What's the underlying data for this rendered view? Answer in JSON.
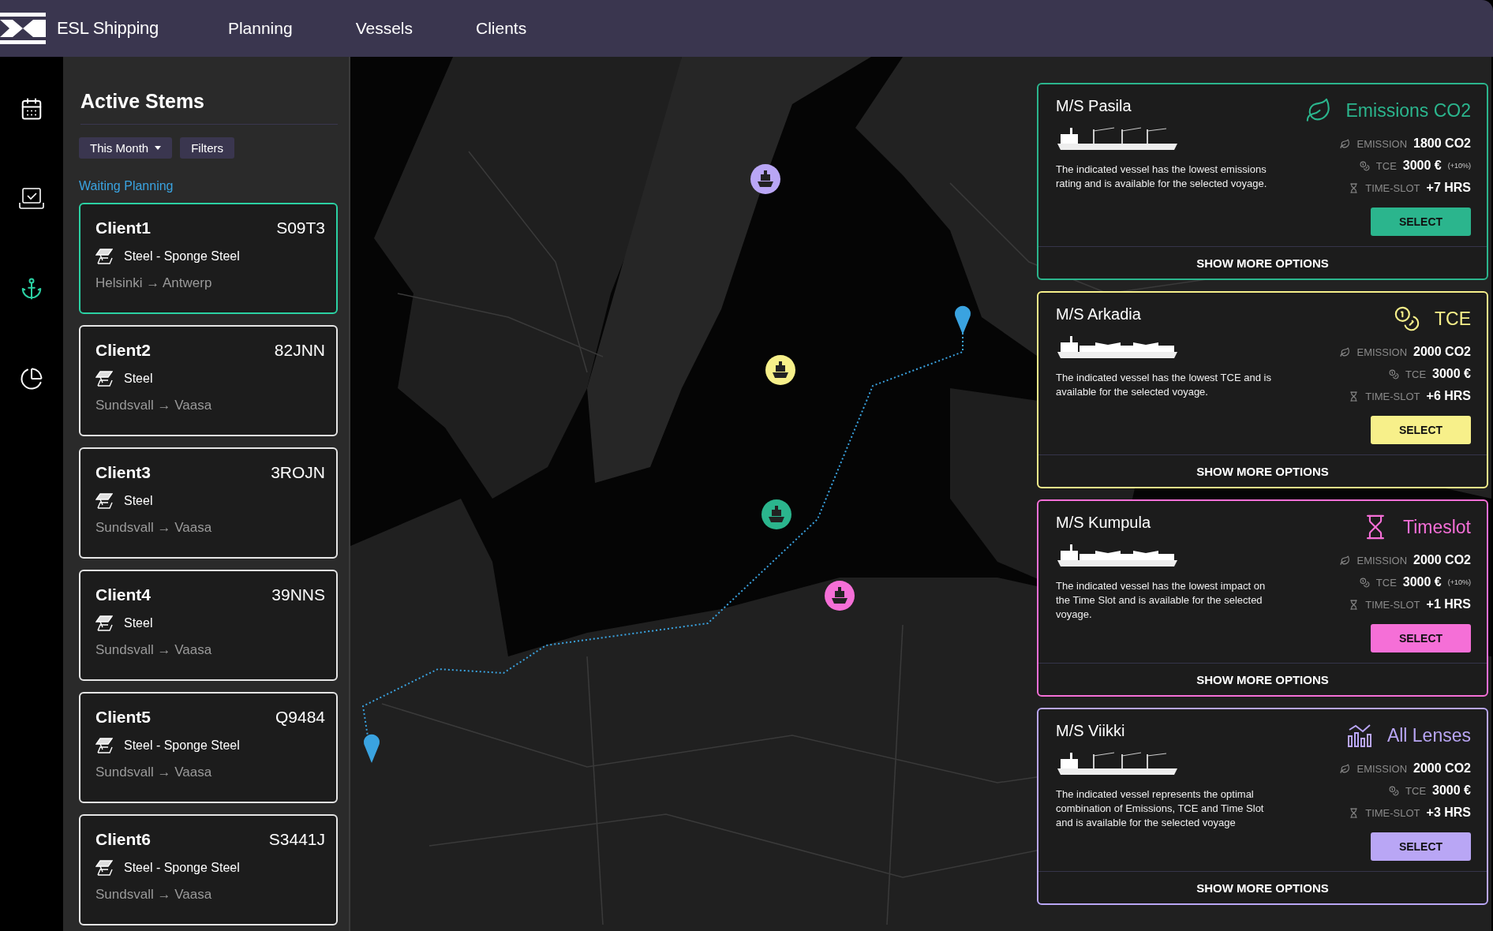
{
  "brand": {
    "name": "ESL Shipping"
  },
  "nav": [
    "Planning",
    "Vessels",
    "Clients"
  ],
  "sidebar": {
    "items": [
      {
        "kind": "calendar",
        "selected": false
      },
      {
        "kind": "laptop",
        "selected": false
      },
      {
        "kind": "anchor",
        "selected": true
      },
      {
        "kind": "pie",
        "selected": false
      }
    ]
  },
  "stems": {
    "title": "Active Stems",
    "filters": [
      {
        "label": "This Month",
        "kind": "dropdown"
      },
      {
        "label": "Filters",
        "kind": "plain"
      }
    ],
    "section": "Waiting Planning",
    "clients": [
      {
        "name": "Client1",
        "code": "S09T3",
        "cargo": "Steel - Sponge Steel",
        "route": "Helsinki → Antwerp",
        "selected": true
      },
      {
        "name": "Client2",
        "code": "82JNN",
        "cargo": "Steel",
        "route": "Sundsvall → Vaasa",
        "selected": false
      },
      {
        "name": "Client3",
        "code": "3ROJN",
        "cargo": "Steel",
        "route": "Sundsvall → Vaasa",
        "selected": false
      },
      {
        "name": "Client4",
        "code": "39NNS",
        "cargo": "Steel",
        "route": "Sundsvall → Vaasa",
        "selected": false
      },
      {
        "name": "Client5",
        "code": "Q9484",
        "cargo": "Steel - Sponge Steel",
        "route": "Sundsvall → Vaasa",
        "selected": false
      },
      {
        "name": "Client6",
        "code": "S3441J",
        "cargo": "Steel - Sponge Steel",
        "route": "Sundsvall → Vaasa",
        "selected": false
      }
    ]
  },
  "map": {
    "markers": [
      {
        "color": "#b9a6f5"
      },
      {
        "color": "#f7f08a"
      },
      {
        "color": "#2bb58d"
      },
      {
        "color": "#f56fd7"
      }
    ]
  },
  "vessels": [
    {
      "name": "M/S Pasila",
      "lens": "Emissions CO2",
      "kind": "emissions",
      "color": "#2bb58d",
      "cranes": true,
      "description": "The indicated vessel has the lowest emissions rating and is available for the selected voyage.",
      "emission_label": "EMISSION",
      "emission": "1800 CO2",
      "tce_label": "TCE",
      "tce": "3000 €",
      "tce_note": "(+10%)",
      "timeslot_label": "TIME-SLOT",
      "timeslot": "+7 HRS",
      "button": "SELECT",
      "more": "SHOW MORE OPTIONS"
    },
    {
      "name": "M/S Arkadia",
      "lens": "TCE",
      "kind": "tce",
      "color": "#f7f08a",
      "cranes": false,
      "description": "The indicated vessel has the lowest TCE and is available for the selected voyage.",
      "emission_label": "EMISSION",
      "emission": "2000 CO2",
      "tce_label": "TCE",
      "tce": "3000 €",
      "timeslot_label": "TIME-SLOT",
      "timeslot": "+6 HRS",
      "button": "SELECT",
      "more": "SHOW MORE OPTIONS"
    },
    {
      "name": "M/S Kumpula",
      "lens": "Timeslot",
      "kind": "timeslot",
      "color": "#f56fd7",
      "cranes": false,
      "description": "The indicated vessel has the lowest impact on the Time Slot and is available for the selected voyage.",
      "emission_label": "EMISSION",
      "emission": "2000 CO2",
      "tce_label": "TCE",
      "tce": "3000 €",
      "tce_note": "(+10%)",
      "timeslot_label": "TIME-SLOT",
      "timeslot": "+1 HRS",
      "button": "SELECT",
      "more": "SHOW MORE OPTIONS"
    },
    {
      "name": "M/S Viikki",
      "lens": "All Lenses",
      "kind": "all",
      "color": "#b9a6f5",
      "cranes": true,
      "description": "The indicated vessel represents the  optimal combination of Emissions, TCE and Time Slot and is available for the selected voyage",
      "emission_label": "EMISSION",
      "emission": "2000 CO2",
      "tce_label": "TCE",
      "tce": "3000 €",
      "timeslot_label": "TIME-SLOT",
      "timeslot": "+3 HRS",
      "button": "SELECT",
      "more": "SHOW MORE OPTIONS"
    }
  ]
}
